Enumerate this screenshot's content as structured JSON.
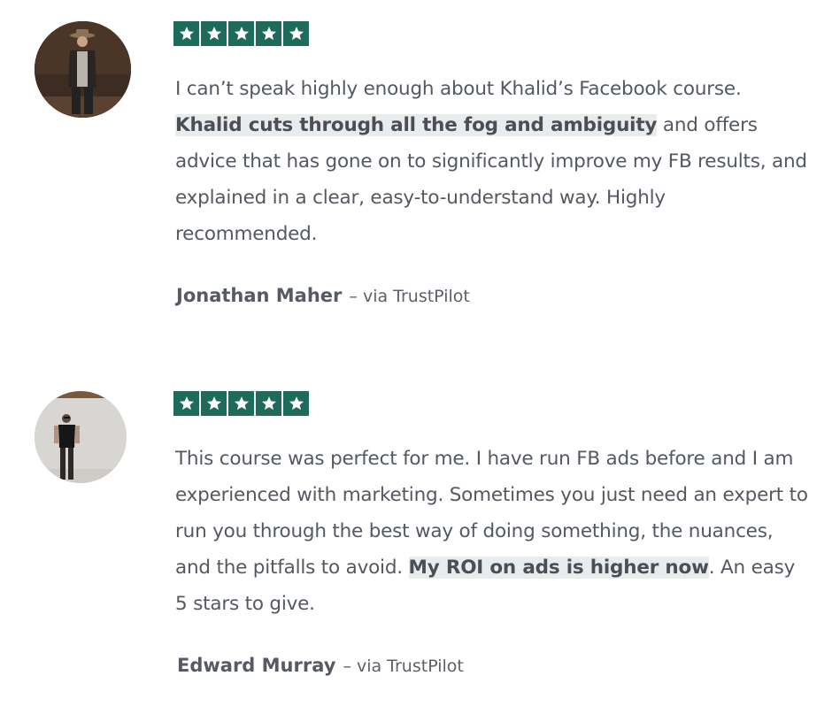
{
  "reviews": [
    {
      "rating": 5,
      "avatar_icon": "person-portrait-avatar",
      "text_before": "I can’t speak highly enough about Khalid’s Facebook course. ",
      "highlight": "Khalid cuts through all the fog and ambiguity",
      "text_after": " and offers advice that has gone on to significantly improve my FB results, and explained in a clear, easy-to-understand way. Highly recommended.",
      "author": "Jonathan Maher",
      "source": "– via TrustPilot"
    },
    {
      "rating": 5,
      "avatar_icon": "person-portrait-avatar",
      "text_before": "This course was perfect for me. I have run FB ads before and I am experienced with marketing. Sometimes you just need an expert to run you through the best way of doing something, the nuances, and the pitfalls to avoid. ",
      "highlight": "My ROI on ads is higher now",
      "text_after": ". An easy 5 stars to give.",
      "author": "Edward Murray",
      "source": "– via TrustPilot"
    }
  ],
  "colors": {
    "star_bg": "#1f6b5b",
    "highlight_bg": "#e8eced",
    "text": "#535861"
  }
}
